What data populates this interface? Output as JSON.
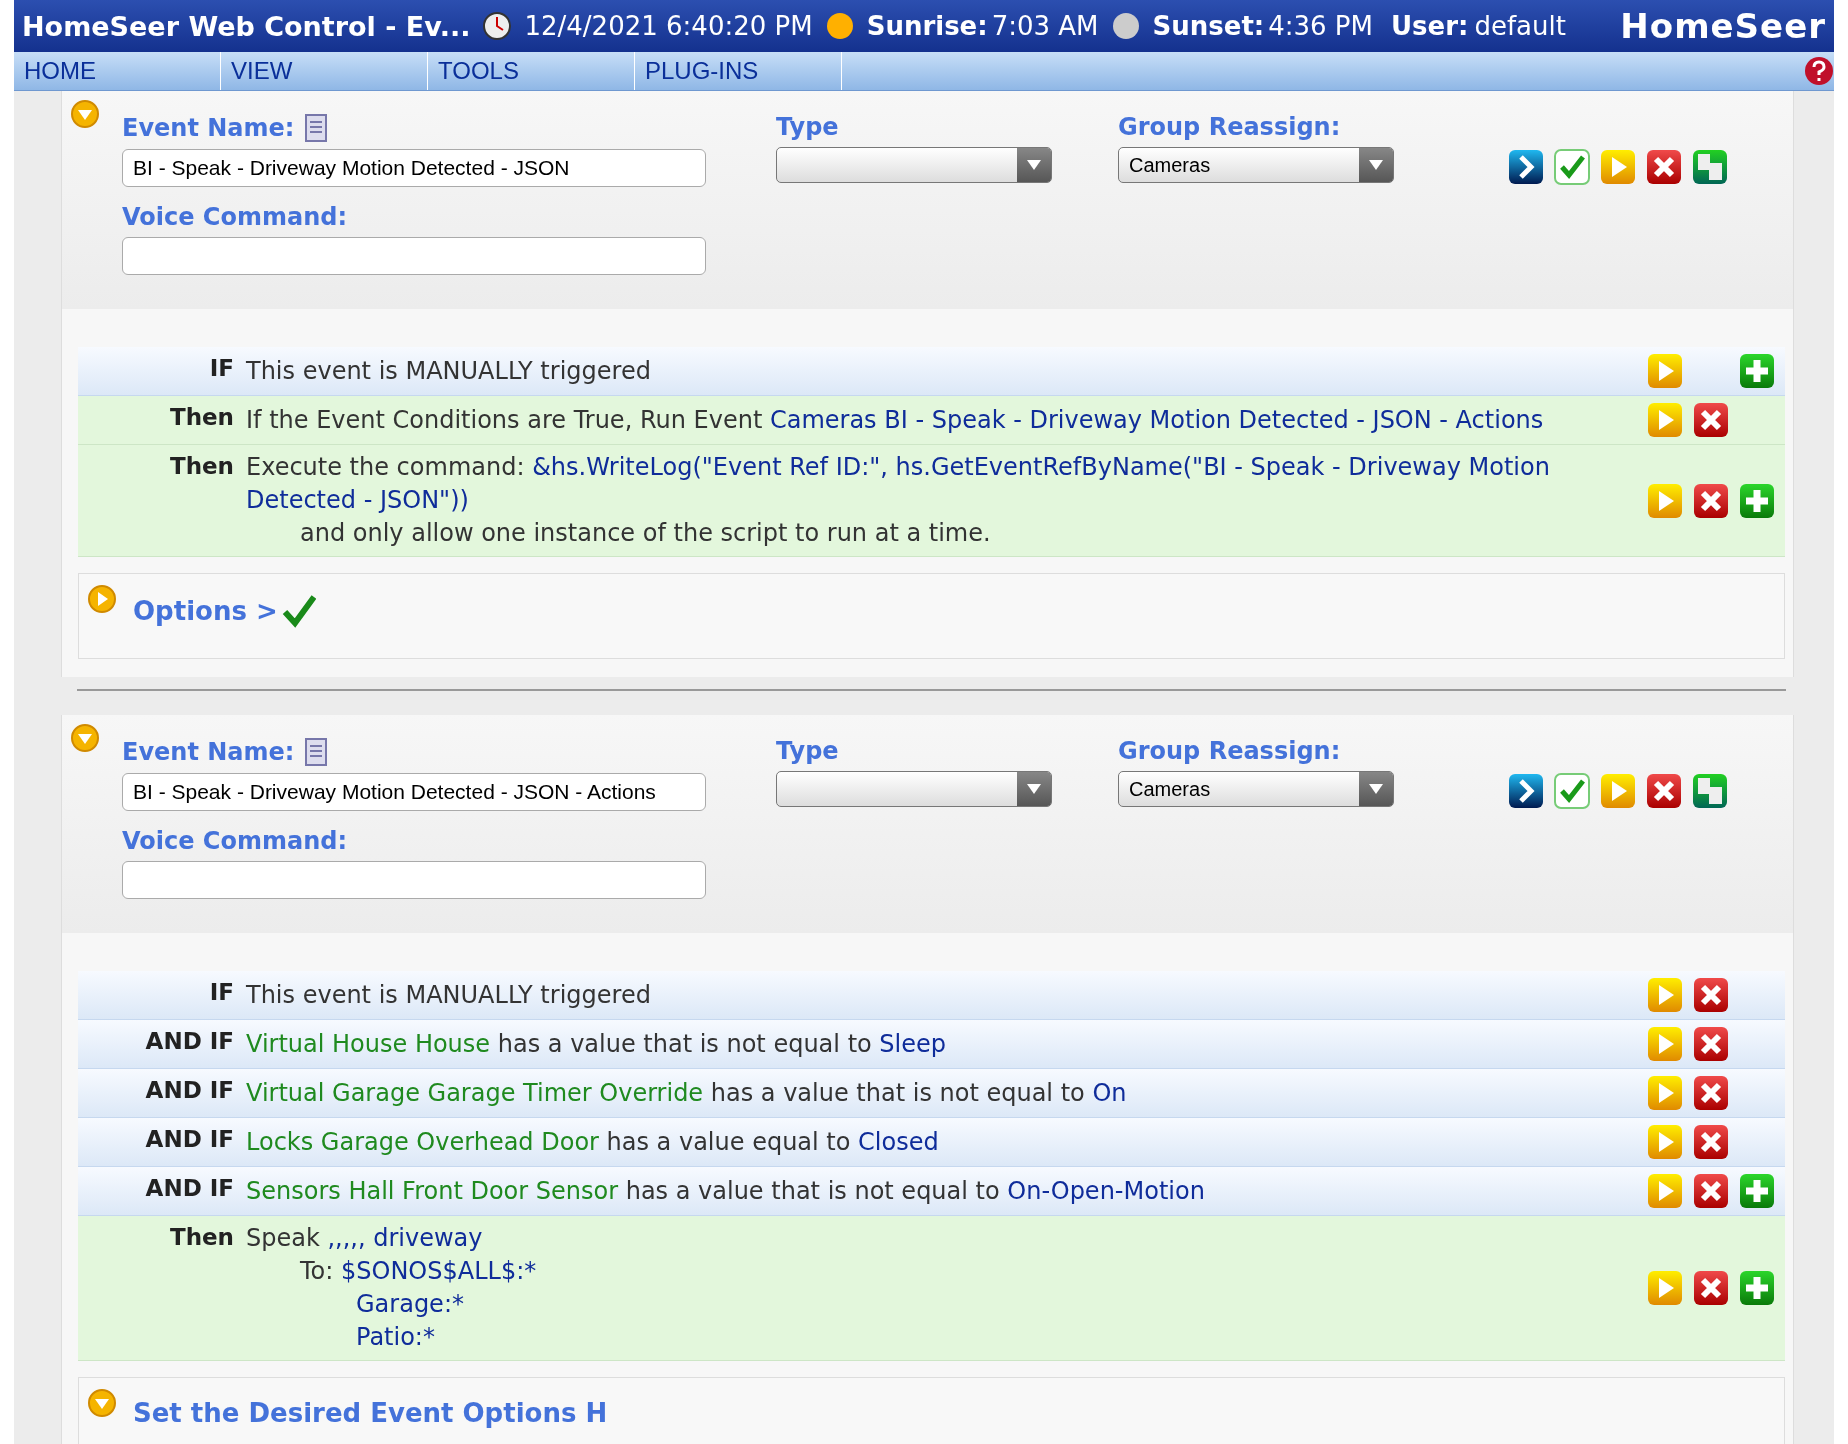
{
  "header": {
    "title": "HomeSeer Web Control - Ev...",
    "datetime": "12/4/2021 6:40:20 PM",
    "sunrise_label": "Sunrise:",
    "sunrise": "7:03 AM",
    "sunset_label": "Sunset:",
    "sunset": "4:36 PM",
    "user_label": "User:",
    "user": "default",
    "logo": "HomeSeer"
  },
  "nav": [
    {
      "label": "HOME"
    },
    {
      "label": "VIEW"
    },
    {
      "label": "TOOLS"
    },
    {
      "label": "PLUG-INS"
    }
  ],
  "events": [
    {
      "expanded": true,
      "name_label": "Event Name:",
      "name_value": "BI - Speak - Driveway Motion Detected - JSON",
      "voice_label": "Voice Command:",
      "type_label": "Type",
      "group_label": "Group Reassign:",
      "group_value": "Cameras",
      "rows": [
        {
          "kind": "trigger",
          "keyword": "IF",
          "lines": [
            [
              {
                "text": "This event is MANUALLY triggered",
                "kind": "plain"
              }
            ]
          ],
          "buttons": [
            {
              "kind": "run"
            },
            {
              "kind": "add"
            }
          ]
        },
        {
          "kind": "action",
          "keyword": "Then",
          "lines": [
            [
              {
                "text": "If the Event Conditions are True, Run Event ",
                "kind": "plain"
              },
              {
                "text": "Cameras BI - Speak - Driveway Motion Detected - JSON - Actions",
                "kind": "value"
              }
            ]
          ],
          "buttons": [
            {
              "kind": "run"
            },
            {
              "kind": "delete"
            }
          ]
        },
        {
          "kind": "action",
          "keyword": "Then",
          "lines": [
            [
              {
                "text": "Execute the command: ",
                "kind": "plain"
              },
              {
                "text": "&hs.WriteLog(\"Event Ref ID:\", hs.GetEventRefByName(\"BI - Speak - Driveway Motion Detected - JSON\"))",
                "kind": "value"
              }
            ],
            [
              {
                "text": "and only allow one instance of the script to run at a time.",
                "kind": "plain"
              }
            ]
          ],
          "buttons": [
            {
              "kind": "run"
            },
            {
              "kind": "delete"
            },
            {
              "kind": "add"
            }
          ]
        }
      ],
      "options": {
        "label": "Options >",
        "expanded": false,
        "checked": true
      }
    },
    {
      "expanded": true,
      "name_label": "Event Name:",
      "name_value": "BI - Speak - Driveway Motion Detected - JSON - Actions",
      "voice_label": "Voice Command:",
      "type_label": "Type",
      "group_label": "Group Reassign:",
      "group_value": "Cameras",
      "rows": [
        {
          "kind": "trigger",
          "keyword": "IF",
          "lines": [
            [
              {
                "text": "This event is MANUALLY triggered",
                "kind": "plain"
              }
            ]
          ],
          "buttons": [
            {
              "kind": "run"
            },
            {
              "kind": "delete"
            }
          ]
        },
        {
          "kind": "trigger",
          "keyword": "AND IF",
          "lines": [
            [
              {
                "text": "Virtual House House",
                "kind": "device"
              },
              {
                "text": " has a value that is not equal to ",
                "kind": "plain"
              },
              {
                "text": "Sleep",
                "kind": "value"
              }
            ]
          ],
          "buttons": [
            {
              "kind": "run"
            },
            {
              "kind": "delete"
            }
          ]
        },
        {
          "kind": "trigger",
          "keyword": "AND IF",
          "lines": [
            [
              {
                "text": "Virtual Garage Garage Timer Override",
                "kind": "device"
              },
              {
                "text": " has a value that is not equal to ",
                "kind": "plain"
              },
              {
                "text": "On",
                "kind": "value"
              }
            ]
          ],
          "buttons": [
            {
              "kind": "run"
            },
            {
              "kind": "delete"
            }
          ]
        },
        {
          "kind": "trigger",
          "keyword": "AND IF",
          "lines": [
            [
              {
                "text": "Locks Garage Overhead Door",
                "kind": "device"
              },
              {
                "text": " has a value equal to ",
                "kind": "plain"
              },
              {
                "text": "Closed",
                "kind": "value"
              }
            ]
          ],
          "buttons": [
            {
              "kind": "run"
            },
            {
              "kind": "delete"
            }
          ]
        },
        {
          "kind": "trigger",
          "keyword": "AND IF",
          "lines": [
            [
              {
                "text": "Sensors Hall Front Door Sensor",
                "kind": "device"
              },
              {
                "text": " has a value that is not equal to ",
                "kind": "plain"
              },
              {
                "text": "On-Open-Motion",
                "kind": "value"
              }
            ]
          ],
          "buttons": [
            {
              "kind": "run"
            },
            {
              "kind": "delete"
            },
            {
              "kind": "add"
            }
          ]
        },
        {
          "kind": "action",
          "keyword": "Then",
          "lines": [
            [
              {
                "text": "Speak ",
                "kind": "plain"
              },
              {
                "text": ",,,,, driveway",
                "kind": "value"
              }
            ],
            [
              {
                "text": "To: ",
                "kind": "plain"
              },
              {
                "text": "$SONOS$ALL$:*",
                "kind": "value"
              }
            ],
            [
              {
                "text": "Garage:*",
                "kind": "value"
              }
            ],
            [
              {
                "text": "Patio:*",
                "kind": "value"
              }
            ]
          ],
          "buttons": [
            {
              "kind": "run"
            },
            {
              "kind": "delete"
            },
            {
              "kind": "add"
            }
          ]
        }
      ],
      "options": {
        "label": "Set the Desired Event Options H",
        "expanded": true,
        "checked": false
      }
    }
  ]
}
